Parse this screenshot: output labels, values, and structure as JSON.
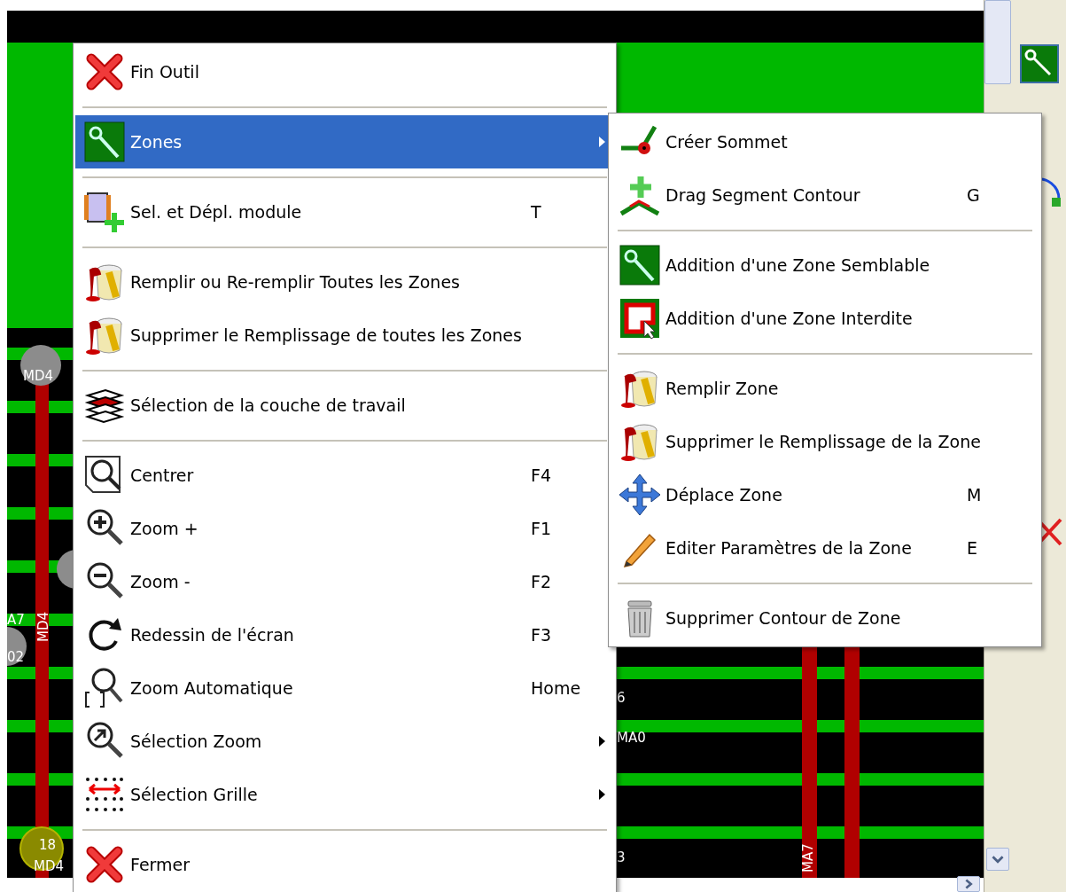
{
  "canvas_labels": [
    "MD4",
    "MD4",
    "A7",
    "02",
    "18",
    "MD4",
    "6",
    "MA0",
    "MA7",
    "3"
  ],
  "menu": {
    "sections": [
      [
        {
          "label": "Fin Outil",
          "has_submenu": false,
          "selected": false
        }
      ],
      [
        {
          "label": "Zones",
          "has_submenu": true,
          "selected": true
        }
      ],
      [
        {
          "label": "Sel. et Dépl. module",
          "shortcut": "T",
          "has_submenu": false,
          "selected": false
        }
      ],
      [
        {
          "label": "Remplir ou Re-remplir Toutes les Zones",
          "has_submenu": false,
          "selected": false
        },
        {
          "label": "Supprimer le Remplissage de toutes les Zones",
          "has_submenu": false,
          "selected": false
        }
      ],
      [
        {
          "label": "Sélection de la couche de travail",
          "has_submenu": false,
          "selected": false
        }
      ],
      [
        {
          "label": "Centrer",
          "shortcut": "F4",
          "has_submenu": false,
          "selected": false
        },
        {
          "label": "Zoom +",
          "shortcut": "F1",
          "has_submenu": false,
          "selected": false
        },
        {
          "label": "Zoom -",
          "shortcut": "F2",
          "has_submenu": false,
          "selected": false
        },
        {
          "label": "Redessin de l'écran",
          "shortcut": "F3",
          "has_submenu": false,
          "selected": false
        },
        {
          "label": "Zoom Automatique",
          "shortcut": "Home",
          "has_submenu": false,
          "selected": false
        },
        {
          "label": "Sélection Zoom",
          "has_submenu": true,
          "selected": false
        },
        {
          "label": "Sélection Grille",
          "has_submenu": true,
          "selected": false
        }
      ],
      [
        {
          "label": "Fermer",
          "has_submenu": false,
          "selected": false
        }
      ]
    ]
  },
  "submenu": {
    "sections": [
      [
        {
          "label": "Créer Sommet",
          "selected": false
        },
        {
          "label": "Drag Segment Contour",
          "shortcut": "G",
          "selected": false
        }
      ],
      [
        {
          "label": "Addition d'une Zone Semblable",
          "selected": false
        },
        {
          "label": "Addition d'une Zone Interdite",
          "selected": false
        }
      ],
      [
        {
          "label": "Remplir Zone",
          "selected": false
        },
        {
          "label": "Supprimer le Remplissage de la Zone",
          "selected": false
        },
        {
          "label": "Déplace Zone",
          "shortcut": "M",
          "selected": false
        },
        {
          "label": "Editer Paramètres de la Zone",
          "shortcut": "E",
          "selected": false
        }
      ],
      [
        {
          "label": "Supprimer Contour de Zone",
          "selected": false
        }
      ]
    ]
  }
}
